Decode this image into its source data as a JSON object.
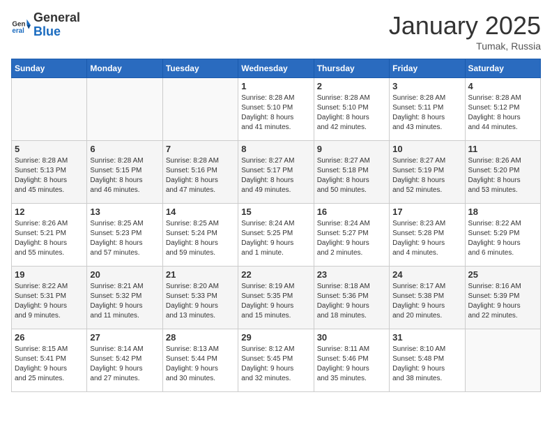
{
  "logo": {
    "general": "General",
    "blue": "Blue"
  },
  "title": "January 2025",
  "location": "Tumak, Russia",
  "days_of_week": [
    "Sunday",
    "Monday",
    "Tuesday",
    "Wednesday",
    "Thursday",
    "Friday",
    "Saturday"
  ],
  "weeks": [
    [
      {
        "day": "",
        "info": ""
      },
      {
        "day": "",
        "info": ""
      },
      {
        "day": "",
        "info": ""
      },
      {
        "day": "1",
        "info": "Sunrise: 8:28 AM\nSunset: 5:10 PM\nDaylight: 8 hours\nand 41 minutes."
      },
      {
        "day": "2",
        "info": "Sunrise: 8:28 AM\nSunset: 5:10 PM\nDaylight: 8 hours\nand 42 minutes."
      },
      {
        "day": "3",
        "info": "Sunrise: 8:28 AM\nSunset: 5:11 PM\nDaylight: 8 hours\nand 43 minutes."
      },
      {
        "day": "4",
        "info": "Sunrise: 8:28 AM\nSunset: 5:12 PM\nDaylight: 8 hours\nand 44 minutes."
      }
    ],
    [
      {
        "day": "5",
        "info": "Sunrise: 8:28 AM\nSunset: 5:13 PM\nDaylight: 8 hours\nand 45 minutes."
      },
      {
        "day": "6",
        "info": "Sunrise: 8:28 AM\nSunset: 5:15 PM\nDaylight: 8 hours\nand 46 minutes."
      },
      {
        "day": "7",
        "info": "Sunrise: 8:28 AM\nSunset: 5:16 PM\nDaylight: 8 hours\nand 47 minutes."
      },
      {
        "day": "8",
        "info": "Sunrise: 8:27 AM\nSunset: 5:17 PM\nDaylight: 8 hours\nand 49 minutes."
      },
      {
        "day": "9",
        "info": "Sunrise: 8:27 AM\nSunset: 5:18 PM\nDaylight: 8 hours\nand 50 minutes."
      },
      {
        "day": "10",
        "info": "Sunrise: 8:27 AM\nSunset: 5:19 PM\nDaylight: 8 hours\nand 52 minutes."
      },
      {
        "day": "11",
        "info": "Sunrise: 8:26 AM\nSunset: 5:20 PM\nDaylight: 8 hours\nand 53 minutes."
      }
    ],
    [
      {
        "day": "12",
        "info": "Sunrise: 8:26 AM\nSunset: 5:21 PM\nDaylight: 8 hours\nand 55 minutes."
      },
      {
        "day": "13",
        "info": "Sunrise: 8:25 AM\nSunset: 5:23 PM\nDaylight: 8 hours\nand 57 minutes."
      },
      {
        "day": "14",
        "info": "Sunrise: 8:25 AM\nSunset: 5:24 PM\nDaylight: 8 hours\nand 59 minutes."
      },
      {
        "day": "15",
        "info": "Sunrise: 8:24 AM\nSunset: 5:25 PM\nDaylight: 9 hours\nand 1 minute."
      },
      {
        "day": "16",
        "info": "Sunrise: 8:24 AM\nSunset: 5:27 PM\nDaylight: 9 hours\nand 2 minutes."
      },
      {
        "day": "17",
        "info": "Sunrise: 8:23 AM\nSunset: 5:28 PM\nDaylight: 9 hours\nand 4 minutes."
      },
      {
        "day": "18",
        "info": "Sunrise: 8:22 AM\nSunset: 5:29 PM\nDaylight: 9 hours\nand 6 minutes."
      }
    ],
    [
      {
        "day": "19",
        "info": "Sunrise: 8:22 AM\nSunset: 5:31 PM\nDaylight: 9 hours\nand 9 minutes."
      },
      {
        "day": "20",
        "info": "Sunrise: 8:21 AM\nSunset: 5:32 PM\nDaylight: 9 hours\nand 11 minutes."
      },
      {
        "day": "21",
        "info": "Sunrise: 8:20 AM\nSunset: 5:33 PM\nDaylight: 9 hours\nand 13 minutes."
      },
      {
        "day": "22",
        "info": "Sunrise: 8:19 AM\nSunset: 5:35 PM\nDaylight: 9 hours\nand 15 minutes."
      },
      {
        "day": "23",
        "info": "Sunrise: 8:18 AM\nSunset: 5:36 PM\nDaylight: 9 hours\nand 18 minutes."
      },
      {
        "day": "24",
        "info": "Sunrise: 8:17 AM\nSunset: 5:38 PM\nDaylight: 9 hours\nand 20 minutes."
      },
      {
        "day": "25",
        "info": "Sunrise: 8:16 AM\nSunset: 5:39 PM\nDaylight: 9 hours\nand 22 minutes."
      }
    ],
    [
      {
        "day": "26",
        "info": "Sunrise: 8:15 AM\nSunset: 5:41 PM\nDaylight: 9 hours\nand 25 minutes."
      },
      {
        "day": "27",
        "info": "Sunrise: 8:14 AM\nSunset: 5:42 PM\nDaylight: 9 hours\nand 27 minutes."
      },
      {
        "day": "28",
        "info": "Sunrise: 8:13 AM\nSunset: 5:44 PM\nDaylight: 9 hours\nand 30 minutes."
      },
      {
        "day": "29",
        "info": "Sunrise: 8:12 AM\nSunset: 5:45 PM\nDaylight: 9 hours\nand 32 minutes."
      },
      {
        "day": "30",
        "info": "Sunrise: 8:11 AM\nSunset: 5:46 PM\nDaylight: 9 hours\nand 35 minutes."
      },
      {
        "day": "31",
        "info": "Sunrise: 8:10 AM\nSunset: 5:48 PM\nDaylight: 9 hours\nand 38 minutes."
      },
      {
        "day": "",
        "info": ""
      }
    ]
  ]
}
